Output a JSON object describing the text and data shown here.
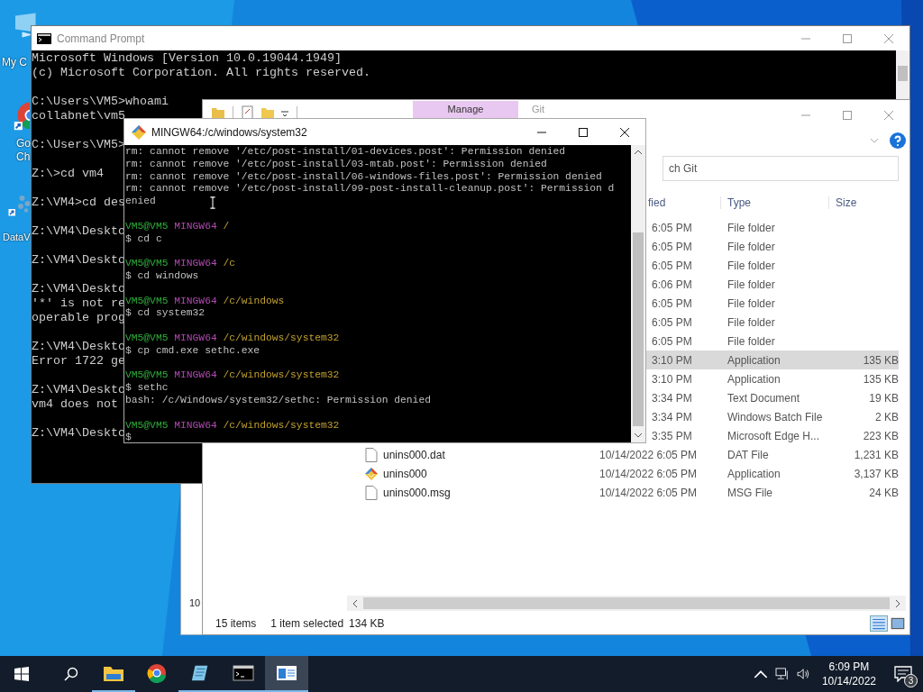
{
  "desktop_icons": [
    {
      "kind": "computer",
      "lines": [
        "My C"
      ]
    },
    {
      "kind": "chrome",
      "lines": [
        "Go",
        "Ch"
      ]
    },
    {
      "kind": "dataviz",
      "lines": [
        "DataV"
      ]
    }
  ],
  "background_window": {
    "text": "10"
  },
  "command_prompt": {
    "title": "Command Prompt",
    "lines": [
      {
        "kind": "text",
        "text": "Microsoft Windows [Version 10.0.19044.1949]"
      },
      {
        "kind": "text",
        "text": "(c) Microsoft Corporation. All rights reserved."
      },
      {
        "kind": "blank"
      },
      {
        "kind": "text",
        "text": "C:\\Users\\VM5>whoami"
      },
      {
        "kind": "text",
        "text": "collabnet\\vm5"
      },
      {
        "kind": "blank"
      },
      {
        "kind": "text",
        "text": "C:\\Users\\VM5>"
      },
      {
        "kind": "blank"
      },
      {
        "kind": "text",
        "text": "Z:\\>cd vm4"
      },
      {
        "kind": "blank"
      },
      {
        "kind": "text",
        "text": "Z:\\VM4>cd des"
      },
      {
        "kind": "blank"
      },
      {
        "kind": "text",
        "text": "Z:\\VM4\\Deskto"
      },
      {
        "kind": "blank"
      },
      {
        "kind": "text",
        "text": "Z:\\VM4\\Deskto"
      },
      {
        "kind": "blank"
      },
      {
        "kind": "text",
        "text": "Z:\\VM4\\Deskto"
      },
      {
        "kind": "text",
        "text": "'*' is not re"
      },
      {
        "kind": "text",
        "text": "operable prog"
      },
      {
        "kind": "blank"
      },
      {
        "kind": "text",
        "text": "Z:\\VM4\\Deskto"
      },
      {
        "kind": "text",
        "text": "Error 1722 ge"
      },
      {
        "kind": "blank"
      },
      {
        "kind": "text",
        "text": "Z:\\VM4\\Deskto"
      },
      {
        "kind": "text",
        "text": "vm4 does not"
      },
      {
        "kind": "blank"
      },
      {
        "kind": "text",
        "text": "Z:\\VM4\\Deskto"
      }
    ]
  },
  "explorer": {
    "contextual_tab": "Manage",
    "title": "Git",
    "search": {
      "placeholder": "ch Git"
    },
    "columns": [
      "fied",
      "Type",
      "Size"
    ],
    "rows": [
      {
        "modified": "6:05 PM",
        "type": "File folder",
        "selected": false
      },
      {
        "modified": "6:05 PM",
        "type": "File folder",
        "selected": false
      },
      {
        "modified": "6:05 PM",
        "type": "File folder",
        "selected": false
      },
      {
        "modified": "6:06 PM",
        "type": "File folder",
        "selected": false
      },
      {
        "modified": "6:05 PM",
        "type": "File folder",
        "selected": false
      },
      {
        "modified": "6:05 PM",
        "type": "File folder",
        "selected": false
      },
      {
        "modified": "6:05 PM",
        "type": "File folder",
        "selected": false
      },
      {
        "modified": "3:10 PM",
        "type": "Application",
        "size": "135 KB",
        "selected": true
      },
      {
        "modified": "3:10 PM",
        "type": "Application",
        "size": "135 KB",
        "selected": false
      },
      {
        "modified": "3:34 PM",
        "type": "Text Document",
        "size": "19 KB",
        "selected": false
      },
      {
        "modified": "3:34 PM",
        "type": "Windows Batch File",
        "size": "2 KB",
        "selected": false
      },
      {
        "modified": "3:35 PM",
        "type": "Microsoft Edge H...",
        "size": "223 KB",
        "selected": false
      },
      {
        "kind": "document",
        "name": "unins000.dat",
        "modified": "10/14/2022 6:05 PM",
        "type": "DAT File",
        "size": "1,231 KB",
        "selected": false
      },
      {
        "kind": "application",
        "name": "unins000",
        "modified": "10/14/2022 6:05 PM",
        "type": "Application",
        "size": "3,137 KB",
        "selected": false
      },
      {
        "kind": "document",
        "name": "unins000.msg",
        "modified": "10/14/2022 6:05 PM",
        "type": "MSG File",
        "size": "24 KB",
        "selected": false
      }
    ],
    "status": {
      "count": "15 items",
      "selection": "1 item selected",
      "size": "134 KB"
    }
  },
  "mingw": {
    "title": "MINGW64:/c/windows/system32",
    "lines": [
      {
        "kind": "text",
        "text": "rm: cannot remove '/etc/post-install/01-devices.post': Permission denied"
      },
      {
        "kind": "text",
        "text": "rm: cannot remove '/etc/post-install/03-mtab.post': Permission denied"
      },
      {
        "kind": "text",
        "text": "rm: cannot remove '/etc/post-install/06-windows-files.post': Permission denied"
      },
      {
        "kind": "text",
        "text": "rm: cannot remove '/etc/post-install/99-post-install-cleanup.post': Permission d"
      },
      {
        "kind": "text",
        "text": "enied"
      },
      {
        "kind": "blank"
      },
      {
        "kind": "prompt",
        "user": "VM5@VM5",
        "system": "MINGW64",
        "path": "/"
      },
      {
        "kind": "text",
        "text": "$ cd c"
      },
      {
        "kind": "blank"
      },
      {
        "kind": "prompt",
        "user": "VM5@VM5",
        "system": "MINGW64",
        "path": "/c"
      },
      {
        "kind": "text",
        "text": "$ cd windows"
      },
      {
        "kind": "blank"
      },
      {
        "kind": "prompt",
        "user": "VM5@VM5",
        "system": "MINGW64",
        "path": "/c/windows"
      },
      {
        "kind": "text",
        "text": "$ cd system32"
      },
      {
        "kind": "blank"
      },
      {
        "kind": "prompt",
        "user": "VM5@VM5",
        "system": "MINGW64",
        "path": "/c/windows/system32"
      },
      {
        "kind": "text",
        "text": "$ cp cmd.exe sethc.exe"
      },
      {
        "kind": "blank"
      },
      {
        "kind": "prompt",
        "user": "VM5@VM5",
        "system": "MINGW64",
        "path": "/c/windows/system32"
      },
      {
        "kind": "text",
        "text": "$ sethc"
      },
      {
        "kind": "text",
        "text": "bash: /c/Windows/system32/sethc: Permission denied"
      },
      {
        "kind": "blank"
      },
      {
        "kind": "prompt",
        "user": "VM5@VM5",
        "system": "MINGW64",
        "path": "/c/windows/system32"
      },
      {
        "kind": "text",
        "text": "$"
      }
    ]
  },
  "taskbar": {
    "apps": [
      {
        "kind": "folder",
        "running": true,
        "selected": false
      },
      {
        "kind": "chrome",
        "running": false,
        "selected": false
      },
      {
        "kind": "notepad",
        "running": true,
        "selected": false
      },
      {
        "kind": "console",
        "running": true,
        "selected": false
      },
      {
        "kind": "window",
        "running": true,
        "selected": true
      }
    ],
    "time": "6:09 PM",
    "date": "10/14/2022",
    "notifications": "3"
  }
}
